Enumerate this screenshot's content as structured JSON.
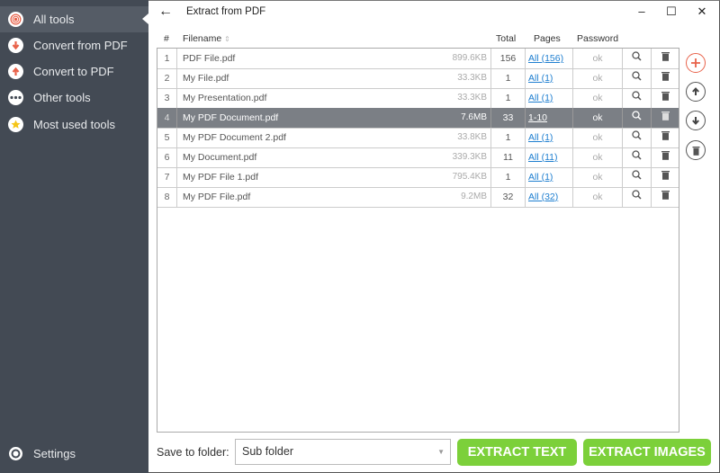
{
  "sidebar": {
    "items": [
      {
        "label": "All tools",
        "icon": "target-icon",
        "active": true
      },
      {
        "label": "Convert from PDF",
        "icon": "arrow-down-icon"
      },
      {
        "label": "Convert to PDF",
        "icon": "arrow-up-icon"
      },
      {
        "label": "Other tools",
        "icon": "ellipsis-icon"
      },
      {
        "label": "Most used tools",
        "icon": "star-icon"
      }
    ],
    "settings_label": "Settings"
  },
  "header": {
    "back_icon": "←",
    "title": "Extract from PDF",
    "minimize": "–",
    "maximize": "☐",
    "close": "✕"
  },
  "table": {
    "columns": {
      "num": "#",
      "filename": "Filename",
      "total": "Total",
      "pages": "Pages",
      "password": "Password"
    },
    "rows": [
      {
        "num": "1",
        "name": "PDF File.pdf",
        "size": "899.6KB",
        "total": "156",
        "pages": "All (156)",
        "password": "ok"
      },
      {
        "num": "2",
        "name": "My File.pdf",
        "size": "33.3KB",
        "total": "1",
        "pages": "All (1)",
        "password": "ok"
      },
      {
        "num": "3",
        "name": "My Presentation.pdf",
        "size": "33.3KB",
        "total": "1",
        "pages": "All (1)",
        "password": "ok"
      },
      {
        "num": "4",
        "name": "My PDF Document.pdf",
        "size": "7.6MB",
        "total": "33",
        "pages": "1-10",
        "password": "ok",
        "selected": true
      },
      {
        "num": "5",
        "name": "My PDF Document 2.pdf",
        "size": "33.8KB",
        "total": "1",
        "pages": "All (1)",
        "password": "ok"
      },
      {
        "num": "6",
        "name": "My Document.pdf",
        "size": "339.3KB",
        "total": "11",
        "pages": "All (11)",
        "password": "ok"
      },
      {
        "num": "7",
        "name": "My PDF File 1.pdf",
        "size": "795.4KB",
        "total": "1",
        "pages": "All (1)",
        "password": "ok"
      },
      {
        "num": "8",
        "name": "My PDF File.pdf",
        "size": "9.2MB",
        "total": "32",
        "pages": "All (32)",
        "password": "ok"
      }
    ]
  },
  "footer": {
    "save_label": "Save to folder:",
    "folder_value": "Sub folder",
    "extract_text": "EXTRACT TEXT",
    "extract_images": "EXTRACT IMAGES"
  },
  "colors": {
    "accent_green": "#7cd03a",
    "add_red": "#e8624a",
    "sidebar_bg": "#434a54",
    "selected_row": "#7b7f85"
  }
}
